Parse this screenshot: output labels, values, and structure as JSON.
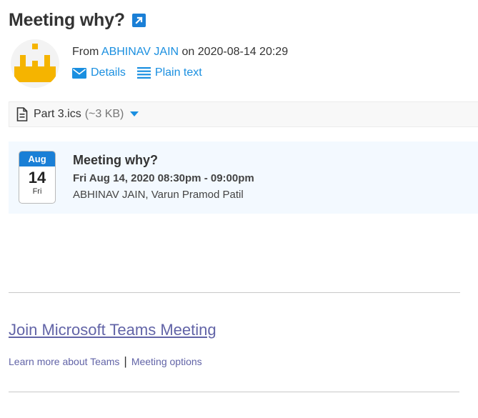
{
  "message": {
    "subject": "Meeting why?",
    "from_prefix": "From",
    "sender": "ABHINAV JAIN",
    "date_prefix": "on",
    "date": "2020-08-14 20:29",
    "links": {
      "details": "Details",
      "plain_text": "Plain text"
    }
  },
  "attachment": {
    "name": "Part 3.ics",
    "size": "(~3 KB)"
  },
  "event": {
    "month": "Aug",
    "day": "14",
    "weekday": "Fri",
    "title": "Meeting why?",
    "time": "Fri Aug 14, 2020 08:30pm - 09:00pm",
    "attendees": "ABHINAV JAIN, Varun Pramod Patil"
  },
  "body": {
    "join_link": "Join Microsoft Teams Meeting",
    "learn_more": "Learn more about Teams",
    "separator": "|",
    "meeting_options": "Meeting options"
  },
  "colors": {
    "accent": "#1a8fe0",
    "teams": "#6264a7",
    "avatar": "#f5b400"
  },
  "icons": [
    "popout-icon",
    "envelope-icon",
    "plain-text-icon",
    "file-icon",
    "caret-down-icon"
  ]
}
